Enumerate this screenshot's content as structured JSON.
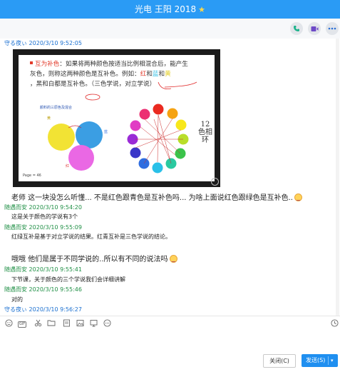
{
  "window": {
    "title": "光电 王阳 2018"
  },
  "toolbar": {
    "call": "phone-icon",
    "video": "video-icon",
    "more": "more-icon"
  },
  "slide": {
    "line1_red": "互为补色",
    "line1_rest": "：如果将两种颜色按适当比例相混合后，能产生",
    "line2": "灰色，则称这两种颜色是互补色。例如：",
    "line2_red": "红",
    "line2_mid": "和",
    "line2_cyan": "蓝",
    "line2_mid2": "和",
    "line2_yellow": "黄",
    "line3": "，黑和白都是互补色。（三色学说，对立学说）",
    "subtitle": "颜料的三原色及混合",
    "label_yellow": "黄",
    "label_blue": "蓝",
    "label_red": "红",
    "wheel_label": "12色相环",
    "page": "Page = 46"
  },
  "messages": [
    {
      "sender": "守る夜ぃ",
      "time": "2020/3/10 9:52:05",
      "text": ""
    },
    {
      "sender": "",
      "time": "",
      "text": "老师 这一块没怎么听懂...  不是红色跟青色是互补色吗... 为啥上面说红色跟绿色是互补色.."
    },
    {
      "sender": "随遇而安",
      "time": "2020/3/10 9:54:20",
      "text": "这是关于颜色的学说有3个"
    },
    {
      "sender": "随遇而安",
      "time": "2020/3/10 9:55:09",
      "text": "红绿互补是基于对立学说的结果。红青互补是三色学说的结论。"
    },
    {
      "sender": "",
      "time": "",
      "text": "哦哦 他们是属于不同学说的..所以有不同的说法吗"
    },
    {
      "sender": "随遇而安",
      "time": "2020/3/10 9:55:41",
      "text": "下节课，关于颜色的三个学说我们会详细讲解"
    },
    {
      "sender": "随遇而安",
      "time": "2020/3/10 9:55:46",
      "text": "对的"
    },
    {
      "sender": "守る夜ぃ",
      "time": "2020/3/10 9:56:27",
      "text": ""
    }
  ],
  "compose": {
    "icons": [
      "emoji-icon",
      "gif-icon",
      "scissors-icon",
      "folder-icon",
      "doc-icon",
      "image-icon",
      "screen-icon",
      "more-dots-icon",
      "history-icon"
    ],
    "gif_label": "GIF"
  },
  "buttons": {
    "close": "关闭(C)",
    "send": "发送(S)"
  },
  "colors": {
    "titlebar": "#2a9bf5",
    "sender_blue": "#1a6fd0",
    "sender_green": "#1f8f45",
    "send_button": "#1f8ff0"
  }
}
